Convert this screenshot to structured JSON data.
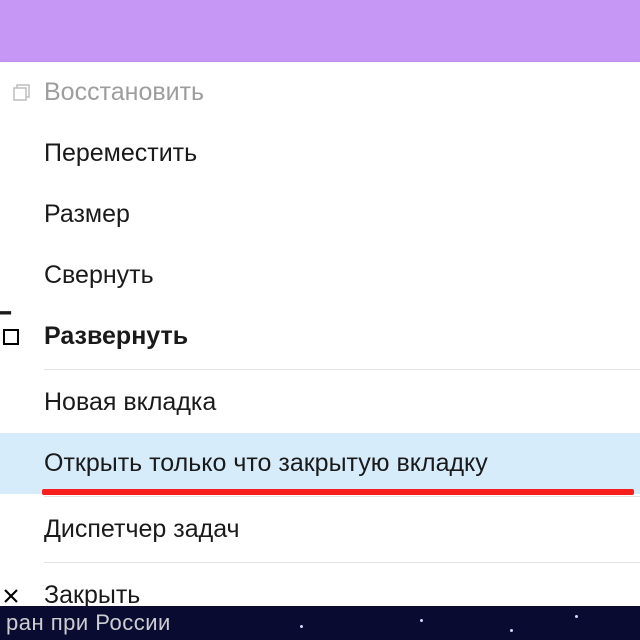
{
  "menu": {
    "restore": "Восстановить",
    "move": "Переместить",
    "size": "Размер",
    "minimize": "Свернуть",
    "maximize": "Развернуть",
    "new_tab": "Новая вкладка",
    "reopen_tab": "Открыть только что закрытую вкладку",
    "task_manager": "Диспетчер задач",
    "close": "Закрыть"
  },
  "background_fragment": "ран при России",
  "colors": {
    "titlebar": "#c697f5",
    "highlight": "#d7ecfa",
    "underline": "#f71e1c"
  }
}
